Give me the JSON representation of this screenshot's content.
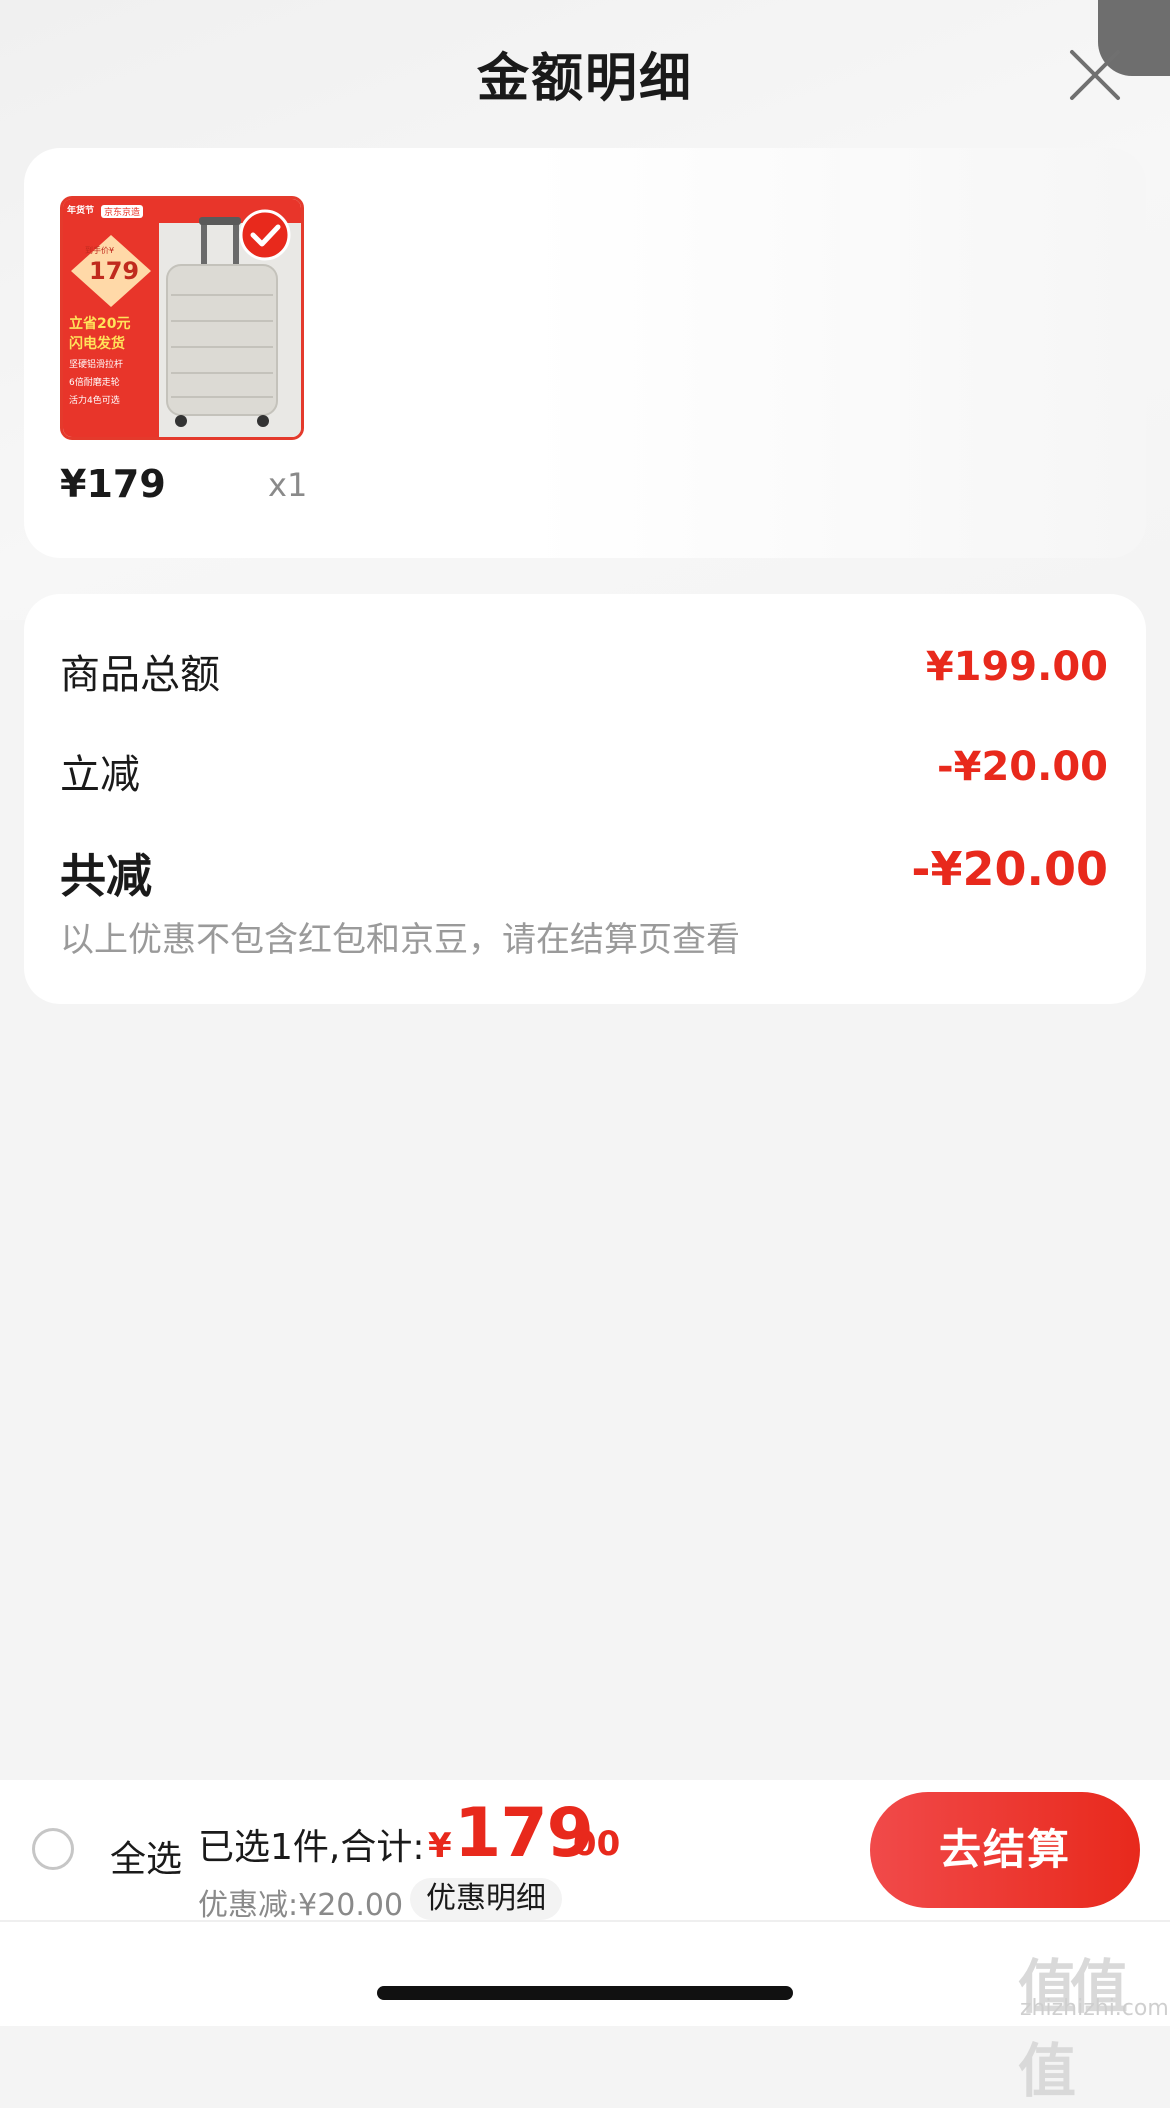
{
  "header": {
    "title": "金额明细"
  },
  "product": {
    "price": "¥179",
    "quantity": "x1",
    "image": {
      "badge_left": "年货节",
      "badge_right": "京东京造",
      "tag_price": "179",
      "tag_price_prefix": "到手价¥",
      "promo_line_1": "立省20元",
      "promo_line_2": "闪电发货",
      "feature_1": "坚硬铝滑拉杆",
      "feature_2": "6倍耐磨走轮",
      "feature_3": "活力4色可选"
    }
  },
  "detail": {
    "rows": [
      {
        "label": "商品总额",
        "value": "¥199.00"
      },
      {
        "label": "立减",
        "value": "-¥20.00"
      },
      {
        "label": "共减",
        "value": "-¥20.00"
      }
    ],
    "note": "以上优惠不包含红包和京豆，请在结算页查看"
  },
  "bottom_bar": {
    "select_all": "全选",
    "selected_text": "已选1件,合计:",
    "currency": "¥",
    "total_int": "179",
    "total_dec": ".00",
    "discount_text": "优惠减:¥20.00",
    "detail_link": "优惠明细",
    "checkout_label": "去结算"
  },
  "watermark": {
    "logo": "值值值",
    "url": "zhizhizhi.com"
  },
  "colors": {
    "accent": "#e8291c",
    "background": "#f4f4f4",
    "card": "#ffffff"
  }
}
